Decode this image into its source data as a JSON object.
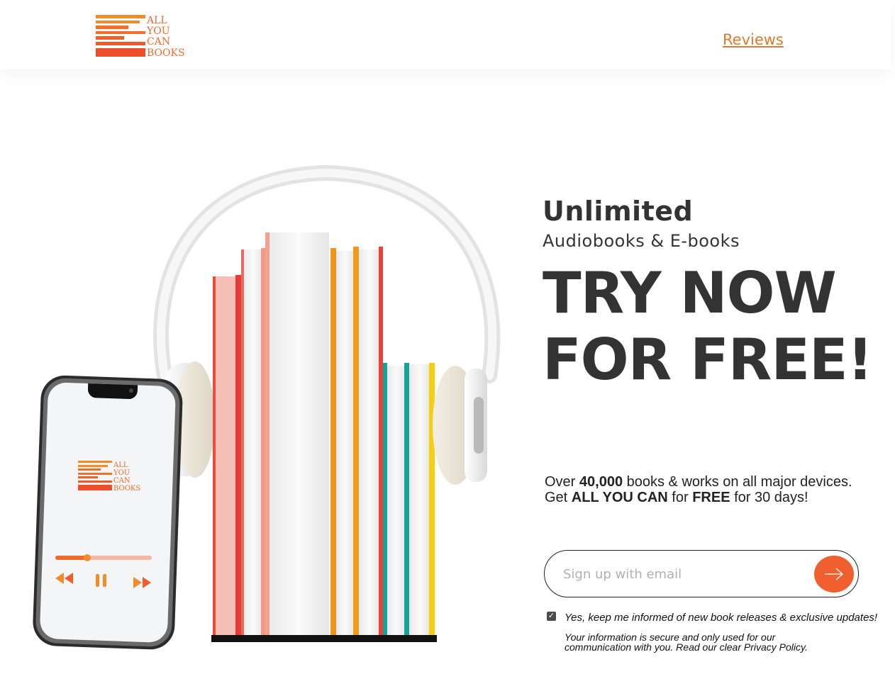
{
  "header": {
    "logo_lines": [
      "ALL",
      "YOU",
      "CAN",
      "BOOKS"
    ],
    "nav_reviews": "Reviews"
  },
  "phone": {
    "logo_lines": [
      "ALL",
      "YOU",
      "CAN",
      "BOOKS"
    ],
    "progress": 0.33
  },
  "hero": {
    "unlimited": "Unlimited",
    "subtitle": "Audiobooks & E-books",
    "cta_line1": "TRY NOW",
    "cta_line2": "FOR FREE!"
  },
  "description": {
    "line1_pre": "Over ",
    "line1_count": "40,000",
    "line1_post": " books & works on all major devices.",
    "line2_pre": "Get ",
    "line2_brand": "ALL YOU CAN",
    "line2_mid": " for ",
    "line2_free": "FREE",
    "line2_post": " for 30 days!"
  },
  "signup": {
    "placeholder": "Sign up with email",
    "value": ""
  },
  "consent": {
    "checked": true,
    "text": "Yes, keep me informed of new book releases & exclusive updates!",
    "privacy_line1": "Your information is secure and only used for our",
    "privacy_line2": "communication with you. Read our clear Privacy Policy."
  },
  "colors": {
    "accent": "#f0602f",
    "nav_link": "#e07b2c",
    "text_dark": "#333333"
  }
}
